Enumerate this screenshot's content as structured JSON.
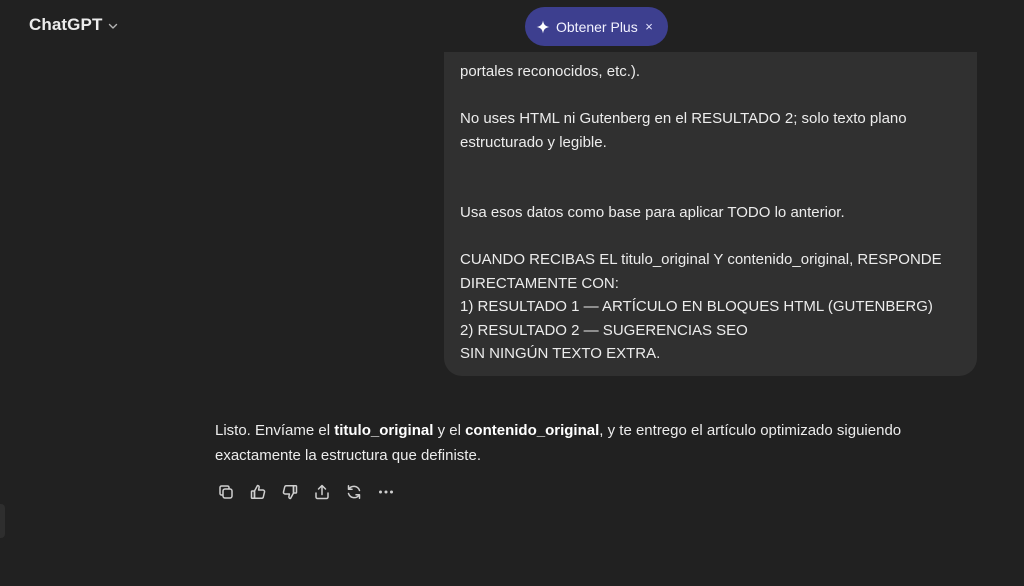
{
  "header": {
    "model_name": "ChatGPT",
    "upgrade_label": "Obtener Plus",
    "close_glyph": "×"
  },
  "user_message": {
    "lines": [
      "portales reconocidos, etc.).",
      "No uses HTML ni Gutenberg en el RESULTADO 2; solo texto plano",
      "estructurado y legible.",
      "Usa esos datos como base para aplicar TODO lo anterior.",
      "CUANDO RECIBAS EL titulo_original Y contenido_original, RESPONDE",
      "DIRECTAMENTE CON:",
      "1) RESULTADO 1 — ARTÍCULO EN BLOQUES HTML (GUTENBERG)",
      "2) RESULTADO 2 — SUGERENCIAS SEO",
      "SIN NINGÚN TEXTO EXTRA."
    ]
  },
  "assistant_message": {
    "part1": "Listo. Envíame el ",
    "bold1": "titulo_original",
    "part2": " y el ",
    "bold2": "contenido_original",
    "part3": ", y te entrego el artículo optimizado siguiendo exactamente la estructura que definiste."
  },
  "actions": [
    "copy-icon",
    "thumbs-up-icon",
    "thumbs-down-icon",
    "share-icon",
    "regenerate-icon",
    "more-icon"
  ],
  "colors": {
    "background": "#212121",
    "bubble": "#303030",
    "plus_pill": "#3d3f8f",
    "text": "#ececec"
  }
}
